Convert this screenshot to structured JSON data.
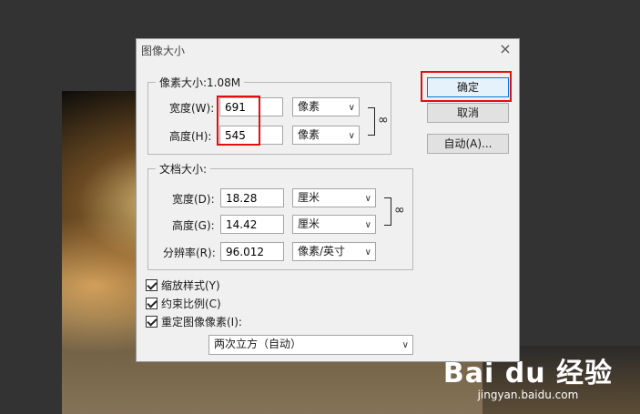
{
  "dialog": {
    "title": "图像大小",
    "close_glyph": "×"
  },
  "pixel_dimensions": {
    "legend": "像素大小:1.08M",
    "width_label": "宽度(W):",
    "width_value": "691",
    "width_unit": "像素",
    "height_label": "高度(H):",
    "height_value": "545",
    "height_unit": "像素"
  },
  "document_size": {
    "legend": "文档大小:",
    "width_label": "宽度(D):",
    "width_value": "18.28",
    "width_unit": "厘米",
    "height_label": "高度(G):",
    "height_value": "14.42",
    "height_unit": "厘米",
    "resolution_label": "分辨率(R):",
    "resolution_value": "96.012",
    "resolution_unit": "像素/英寸"
  },
  "options": {
    "scale_styles": "缩放样式(Y)",
    "constrain_proportions": "约束比例(C)",
    "resample": "重定图像像素(I):",
    "resample_method": "两次立方（自动）"
  },
  "buttons": {
    "ok": "确定",
    "cancel": "取消",
    "auto": "自动(A)..."
  },
  "watermark": {
    "logo": "Bai du 经验",
    "url": "jingyan.baidu.com"
  },
  "colors": {
    "highlight": "#e01010",
    "primary_border": "#0078d7"
  },
  "icons": {
    "chain": "link-icon",
    "dropdown": "chevron-down-icon",
    "close": "close-icon"
  }
}
